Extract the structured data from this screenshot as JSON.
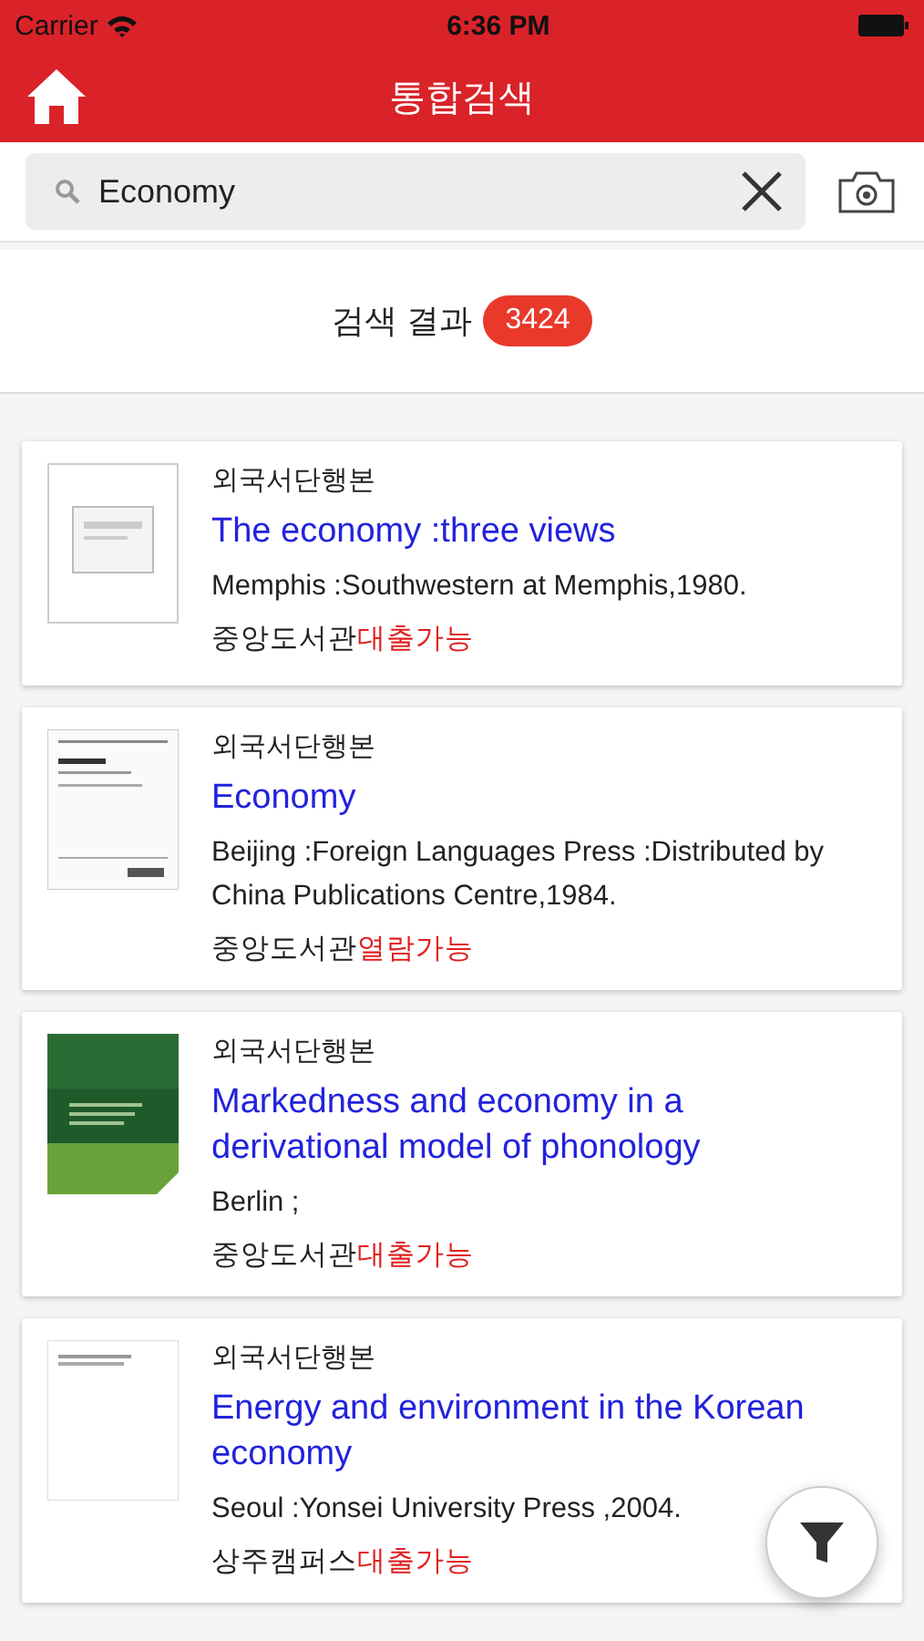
{
  "status_bar": {
    "carrier": "Carrier",
    "time": "6:36 PM"
  },
  "header": {
    "title": "통합검색"
  },
  "search": {
    "value": "Economy"
  },
  "results": {
    "label": "검색 결과",
    "count": "3424"
  },
  "items": [
    {
      "kind": "no-image",
      "type": "외국서단행본",
      "title": "The economy :three views",
      "publication": "Memphis :Southwestern at Memphis,1980.",
      "library": "중앙도서관",
      "availability": "대출가능"
    },
    {
      "kind": "picture",
      "type": "외국서단행본",
      "title": "Economy",
      "publication": "Beijing :Foreign Languages Press :Distributed by China Publications Centre,1984.",
      "library": "중앙도서관",
      "availability": "열람가능"
    },
    {
      "kind": "picture",
      "type": "외국서단행본",
      "title": "Markedness and economy in a derivational model of phonology",
      "publication": "Berlin ;",
      "library": "중앙도서관",
      "availability": "대출가능"
    },
    {
      "kind": "picture",
      "type": "외국서단행본",
      "title": "Energy and environment in the Korean economy",
      "publication": "Seoul :Yonsei University Press ,2004.",
      "library": "상주캠퍼스",
      "availability": "대출가능"
    }
  ]
}
